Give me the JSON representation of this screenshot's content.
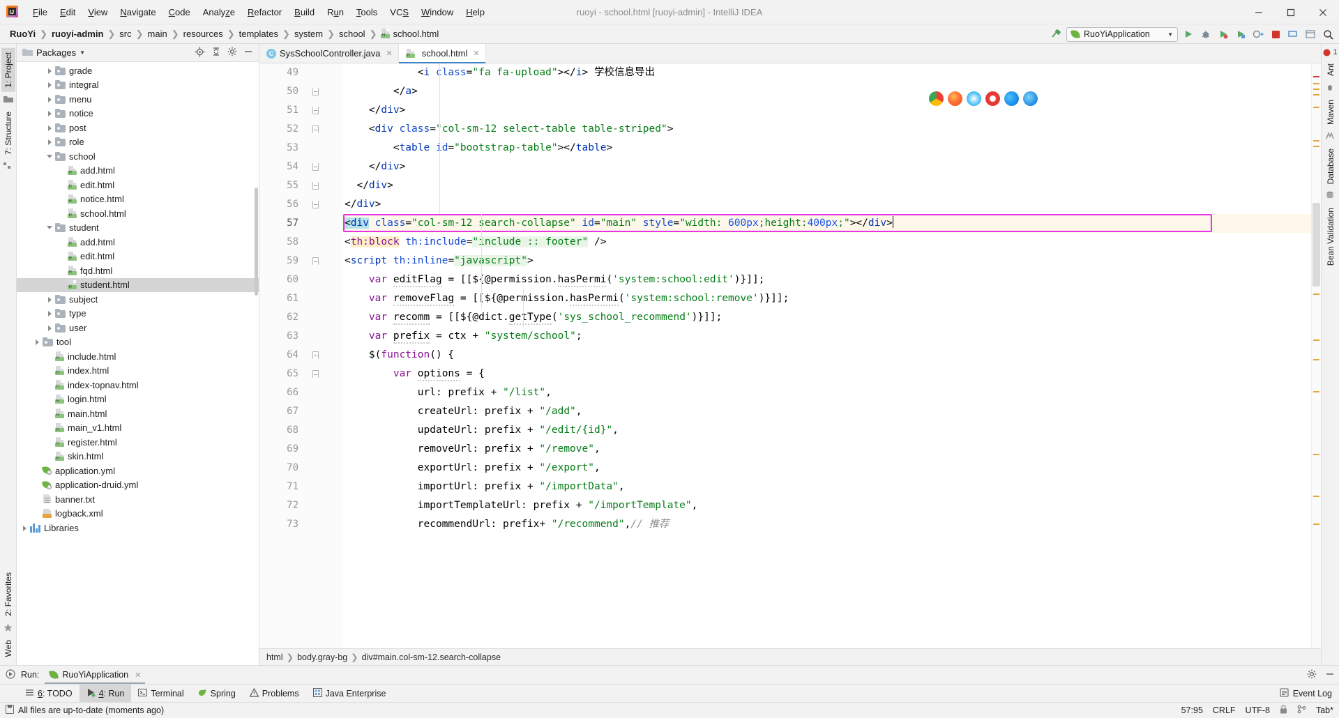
{
  "window": {
    "title": "ruoyi - school.html [ruoyi-admin] - IntelliJ IDEA",
    "minimize": "—",
    "maximize": "❐",
    "close": "✕"
  },
  "menu": [
    "File",
    "Edit",
    "View",
    "Navigate",
    "Code",
    "Analyze",
    "Refactor",
    "Build",
    "Run",
    "Tools",
    "VCS",
    "Window",
    "Help"
  ],
  "breadcrumb": {
    "items": [
      "RuoYi",
      "ruoyi-admin",
      "src",
      "main",
      "resources",
      "templates",
      "system",
      "school",
      "school.html"
    ],
    "separator": "❯"
  },
  "toolbar": {
    "run_config": "RuoYiApplication",
    "caret": "▼",
    "icons": [
      "hammer-icon",
      "run-icon",
      "debug-icon",
      "run-coverage-icon",
      "profiler-icon",
      "attach-icon",
      "stop-icon",
      "update-icon",
      "layout-icon",
      "search-everywhere-icon"
    ]
  },
  "left_rail": {
    "tabs": [
      "1: Project",
      "7: Structure"
    ]
  },
  "right_rail": {
    "tabs": [
      "Ant",
      "Maven",
      "Database",
      "Bean Validation"
    ]
  },
  "bottom_left_rail": {
    "tabs": [
      "2: Favorites",
      "Web"
    ]
  },
  "project_panel": {
    "title": "Packages",
    "dropdown_caret": "▼",
    "actions": [
      "locate-icon",
      "collapse-all-icon",
      "settings-icon",
      "hide-icon"
    ],
    "tree": [
      {
        "label": "grade",
        "depth": 3,
        "type": "folder",
        "state": "collapsed"
      },
      {
        "label": "integral",
        "depth": 3,
        "type": "folder",
        "state": "collapsed"
      },
      {
        "label": "menu",
        "depth": 3,
        "type": "folder",
        "state": "collapsed"
      },
      {
        "label": "notice",
        "depth": 3,
        "type": "folder",
        "state": "collapsed"
      },
      {
        "label": "post",
        "depth": 3,
        "type": "folder",
        "state": "collapsed"
      },
      {
        "label": "role",
        "depth": 3,
        "type": "folder",
        "state": "collapsed"
      },
      {
        "label": "school",
        "depth": 3,
        "type": "folder",
        "state": "expanded"
      },
      {
        "label": "add.html",
        "depth": 4,
        "type": "html"
      },
      {
        "label": "edit.html",
        "depth": 4,
        "type": "html"
      },
      {
        "label": "notice.html",
        "depth": 4,
        "type": "html"
      },
      {
        "label": "school.html",
        "depth": 4,
        "type": "html"
      },
      {
        "label": "student",
        "depth": 3,
        "type": "folder",
        "state": "expanded"
      },
      {
        "label": "add.html",
        "depth": 4,
        "type": "html"
      },
      {
        "label": "edit.html",
        "depth": 4,
        "type": "html"
      },
      {
        "label": "fqd.html",
        "depth": 4,
        "type": "html"
      },
      {
        "label": "student.html",
        "depth": 4,
        "type": "html",
        "selected": true
      },
      {
        "label": "subject",
        "depth": 3,
        "type": "folder",
        "state": "collapsed"
      },
      {
        "label": "type",
        "depth": 3,
        "type": "folder",
        "state": "collapsed"
      },
      {
        "label": "user",
        "depth": 3,
        "type": "folder",
        "state": "collapsed"
      },
      {
        "label": "tool",
        "depth": 2,
        "type": "folder",
        "state": "collapsed"
      },
      {
        "label": "include.html",
        "depth": 3,
        "type": "html"
      },
      {
        "label": "index.html",
        "depth": 3,
        "type": "html"
      },
      {
        "label": "index-topnav.html",
        "depth": 3,
        "type": "html"
      },
      {
        "label": "login.html",
        "depth": 3,
        "type": "html"
      },
      {
        "label": "main.html",
        "depth": 3,
        "type": "html"
      },
      {
        "label": "main_v1.html",
        "depth": 3,
        "type": "html"
      },
      {
        "label": "register.html",
        "depth": 3,
        "type": "html"
      },
      {
        "label": "skin.html",
        "depth": 3,
        "type": "html"
      },
      {
        "label": "application.yml",
        "depth": 2,
        "type": "yml"
      },
      {
        "label": "application-druid.yml",
        "depth": 2,
        "type": "yml"
      },
      {
        "label": "banner.txt",
        "depth": 2,
        "type": "txt"
      },
      {
        "label": "logback.xml",
        "depth": 2,
        "type": "xml"
      },
      {
        "label": "Libraries",
        "depth": 1,
        "type": "library",
        "state": "collapsed"
      }
    ]
  },
  "editor": {
    "tabs": [
      {
        "label": "SysSchoolController.java",
        "icon": "java-class-icon",
        "active": false,
        "close": "✕"
      },
      {
        "label": "school.html",
        "icon": "html-file-icon",
        "active": true,
        "close": "✕"
      }
    ],
    "first_line": 49,
    "lines": [
      {
        "n": 49,
        "fold": "none",
        "html": "<span class='t-punc'>            &lt;</span><span class='t-tag'>i</span> <span class='t-attr'>class</span><span class='t-punc'>=</span><span class='t-val'>\"fa fa-upload\"</span><span class='t-punc'>&gt;&lt;/</span><span class='t-tag'>i</span><span class='t-punc'>&gt;</span> <span class='t-cn'>学校信息导出</span>"
      },
      {
        "n": 50,
        "fold": "bot",
        "html": "<span class='t-punc'>        &lt;/</span><span class='t-tag'>a</span><span class='t-punc'>&gt;</span>"
      },
      {
        "n": 51,
        "fold": "bot",
        "html": "<span class='t-punc'>    &lt;/</span><span class='t-tag'>div</span><span class='t-punc'>&gt;</span>"
      },
      {
        "n": 52,
        "fold": "top",
        "html": "<span class='t-punc'>    &lt;</span><span class='t-tag'>div</span> <span class='t-attr'>class</span><span class='t-punc'>=</span><span class='t-val'>\"col-sm-12 select-table table-striped\"</span><span class='t-punc'>&gt;</span>"
      },
      {
        "n": 53,
        "fold": "none",
        "html": "<span class='t-punc'>        &lt;</span><span class='t-tag'>table</span> <span class='t-attr'>id</span><span class='t-punc'>=</span><span class='t-val'>\"bootstrap-table\"</span><span class='t-punc'>&gt;&lt;/</span><span class='t-tag'>table</span><span class='t-punc'>&gt;</span>"
      },
      {
        "n": 54,
        "fold": "bot",
        "html": "<span class='t-punc'>    &lt;/</span><span class='t-tag'>div</span><span class='t-punc'>&gt;</span>"
      },
      {
        "n": 55,
        "fold": "bot",
        "html": "<span class='t-punc'>  &lt;/</span><span class='t-tag'>div</span><span class='t-punc'>&gt;</span>"
      },
      {
        "n": 56,
        "fold": "bot",
        "html": "<span class='t-punc'>&lt;/</span><span class='t-tag'>div</span><span class='t-punc'>&gt;</span>"
      },
      {
        "n": 57,
        "fold": "none",
        "cur": true,
        "html": "<span class='hl-cyan t-punc'>&lt;</span><span class='hl-cyan t-tag'>div</span> <span class='t-attr'>class</span><span class='t-punc'>=</span><span class='t-val'>\"col-sm-12 search-collapse\"</span> <span class='t-attr'>id</span><span class='t-punc'>=</span><span class='t-val'>\"main\"</span> <span class='t-attr'>style</span><span class='t-punc'>=</span><span class='t-val'>\"width: </span><span class='t-num'>600px</span><span class='t-val'>;height:</span><span class='t-num'>400px</span><span class='t-val'>;\"</span><span class='t-punc'>&gt;&lt;/</span><span class='t-tag'>div</span><span class='t-punc'>&gt;</span><span class='caret-bar'></span>"
      },
      {
        "n": 58,
        "fold": "none",
        "html": "<span class='t-punc'>&lt;</span><span class='hl-yellow t-ns'>th:block</span> <span class='t-attr'>th:include</span><span class='t-punc'>=</span><span class='hl-green t-val'>\"include :: footer\"</span> <span class='t-punc'>/&gt;</span>"
      },
      {
        "n": 59,
        "fold": "top",
        "html": "<span class='t-punc'>&lt;</span><span class='t-tag'>script</span> <span class='t-attr'>th:inline</span><span class='t-punc'>=</span><span class='hl-green t-val'>\"javascript\"</span><span class='t-punc'>&gt;</span>"
      },
      {
        "n": 60,
        "fold": "none",
        "html": "<span class='t-punc'>    </span><span class='t-js'>var</span> <span class='t-plain squiggle'>editFlag</span> <span class='t-punc'>= [[${@</span><span class='t-plain'>permission</span><span class='t-punc'>.</span><span class='t-plain squiggle'>hasPermi</span><span class='t-punc'>(</span><span class='t-str'>'system:school:edit'</span><span class='t-punc'>)}]];</span>"
      },
      {
        "n": 61,
        "fold": "none",
        "html": "<span class='t-punc'>    </span><span class='t-js'>var</span> <span class='t-plain squiggle'>removeFlag</span> <span class='t-punc'>= [[${@</span><span class='t-plain'>permission</span><span class='t-punc'>.</span><span class='t-plain squiggle'>hasPermi</span><span class='t-punc'>(</span><span class='t-str'>'system:school:remove'</span><span class='t-punc'>)}]];</span>"
      },
      {
        "n": 62,
        "fold": "none",
        "html": "<span class='t-punc'>    </span><span class='t-js'>var</span> <span class='t-plain squiggle'>recomm</span> <span class='t-punc'>= [[${@</span><span class='t-plain'>dict</span><span class='t-punc'>.</span><span class='t-plain squiggle'>getType</span><span class='t-punc'>(</span><span class='t-str'>'sys_school_recommend'</span><span class='t-punc'>)}]];</span>"
      },
      {
        "n": 63,
        "fold": "none",
        "html": "<span class='t-punc'>    </span><span class='t-js'>var</span> <span class='t-plain squiggle'>prefix</span> <span class='t-punc'>= </span><span class='t-plain'>ctx</span> <span class='t-punc'>+ </span><span class='t-str'>\"system/school\"</span><span class='t-punc'>;</span>"
      },
      {
        "n": 64,
        "fold": "top",
        "html": "<span class='t-punc'>    $(</span><span class='t-js'>function</span><span class='t-punc'>() {</span>"
      },
      {
        "n": 65,
        "fold": "top",
        "html": "<span class='t-punc'>        </span><span class='t-js'>var</span> <span class='t-plain squiggle'>options</span> <span class='t-punc'>= {</span>"
      },
      {
        "n": 66,
        "fold": "none",
        "html": "<span class='t-punc'>            </span><span class='t-plain'>url</span><span class='t-punc'>: </span><span class='t-plain'>prefix</span> <span class='t-punc'>+ </span><span class='t-str'>\"/list\"</span><span class='t-punc'>,</span>"
      },
      {
        "n": 67,
        "fold": "none",
        "html": "<span class='t-punc'>            </span><span class='t-plain'>createUrl</span><span class='t-punc'>: </span><span class='t-plain'>prefix</span> <span class='t-punc'>+ </span><span class='t-str'>\"/add\"</span><span class='t-punc'>,</span>"
      },
      {
        "n": 68,
        "fold": "none",
        "html": "<span class='t-punc'>            </span><span class='t-plain'>updateUrl</span><span class='t-punc'>: </span><span class='t-plain'>prefix</span> <span class='t-punc'>+ </span><span class='t-str'>\"/edit/{id}\"</span><span class='t-punc'>,</span>"
      },
      {
        "n": 69,
        "fold": "none",
        "html": "<span class='t-punc'>            </span><span class='t-plain'>removeUrl</span><span class='t-punc'>: </span><span class='t-plain'>prefix</span> <span class='t-punc'>+ </span><span class='t-str'>\"/remove\"</span><span class='t-punc'>,</span>"
      },
      {
        "n": 70,
        "fold": "none",
        "html": "<span class='t-punc'>            </span><span class='t-plain'>exportUrl</span><span class='t-punc'>: </span><span class='t-plain'>prefix</span> <span class='t-punc'>+ </span><span class='t-str'>\"/export\"</span><span class='t-punc'>,</span>"
      },
      {
        "n": 71,
        "fold": "none",
        "html": "<span class='t-punc'>            </span><span class='t-plain'>importUrl</span><span class='t-punc'>: </span><span class='t-plain'>prefix</span> <span class='t-punc'>+ </span><span class='t-str'>\"/importData\"</span><span class='t-punc'>,</span>"
      },
      {
        "n": 72,
        "fold": "none",
        "html": "<span class='t-punc'>            </span><span class='t-plain'>importTemplateUrl</span><span class='t-punc'>: </span><span class='t-plain'>prefix</span> <span class='t-punc'>+ </span><span class='t-str'>\"/importTemplate\"</span><span class='t-punc'>,</span>"
      },
      {
        "n": 73,
        "fold": "none",
        "html": "<span class='t-punc'>            </span><span class='t-plain'>recommendUrl</span><span class='t-punc'>: </span><span class='t-plain'>prefix</span><span class='t-punc'>+ </span><span class='t-str'>\"/recommend\"</span><span class='t-punc'>,</span><span class='t-comment'>// 推荐</span>"
      }
    ],
    "error_count": "1",
    "browser_icons": [
      "chrome-icon",
      "firefox-icon",
      "safari-icon",
      "opera-icon",
      "edge-icon",
      "ie-icon"
    ]
  },
  "editor_breadcrumb": {
    "items": [
      "html",
      "body.gray-bg",
      "div#main.col-sm-12.search-collapse"
    ],
    "separator": "❯"
  },
  "run_window": {
    "label": "Run:",
    "tab": "RuoYiApplication",
    "close": "✕",
    "settings_icon": "gear-icon",
    "hide_icon": "minimize-icon"
  },
  "bottom_tabs": [
    {
      "label": "6: TODO",
      "underline": "6",
      "icon": "todo-icon",
      "active": false
    },
    {
      "label": "4: Run",
      "underline": "4",
      "icon": "run-icon",
      "active": true
    },
    {
      "label": "Terminal",
      "icon": "terminal-icon",
      "active": false
    },
    {
      "label": "Spring",
      "icon": "spring-icon",
      "active": false
    },
    {
      "label": "Problems",
      "icon": "warning-icon",
      "active": false
    },
    {
      "label": "Java Enterprise",
      "icon": "java-enterprise-icon",
      "active": false
    }
  ],
  "bottom_tabs_right": {
    "label": "Event Log",
    "icon": "event-log-icon"
  },
  "statusbar": {
    "message": "All files are up-to-date (moments ago)",
    "message_icon": "save-icon",
    "caret_position": "57:95",
    "line_separator": "CRLF",
    "encoding": "UTF-8",
    "lock_icon": "lock-icon",
    "branch_icon": "branch-icon",
    "indent": "Tab*"
  },
  "colors": {
    "accent_blue": "#4083c9",
    "selection_magenta": "#e832e8",
    "highlight_line": "#fdf8e9",
    "tag_blue": "#0033b3",
    "string_green": "#067d17",
    "keyword_purple": "#871094",
    "panel_bg": "#f2f2f2",
    "editor_bg": "#ffffff",
    "spring_green": "#6db33f"
  }
}
